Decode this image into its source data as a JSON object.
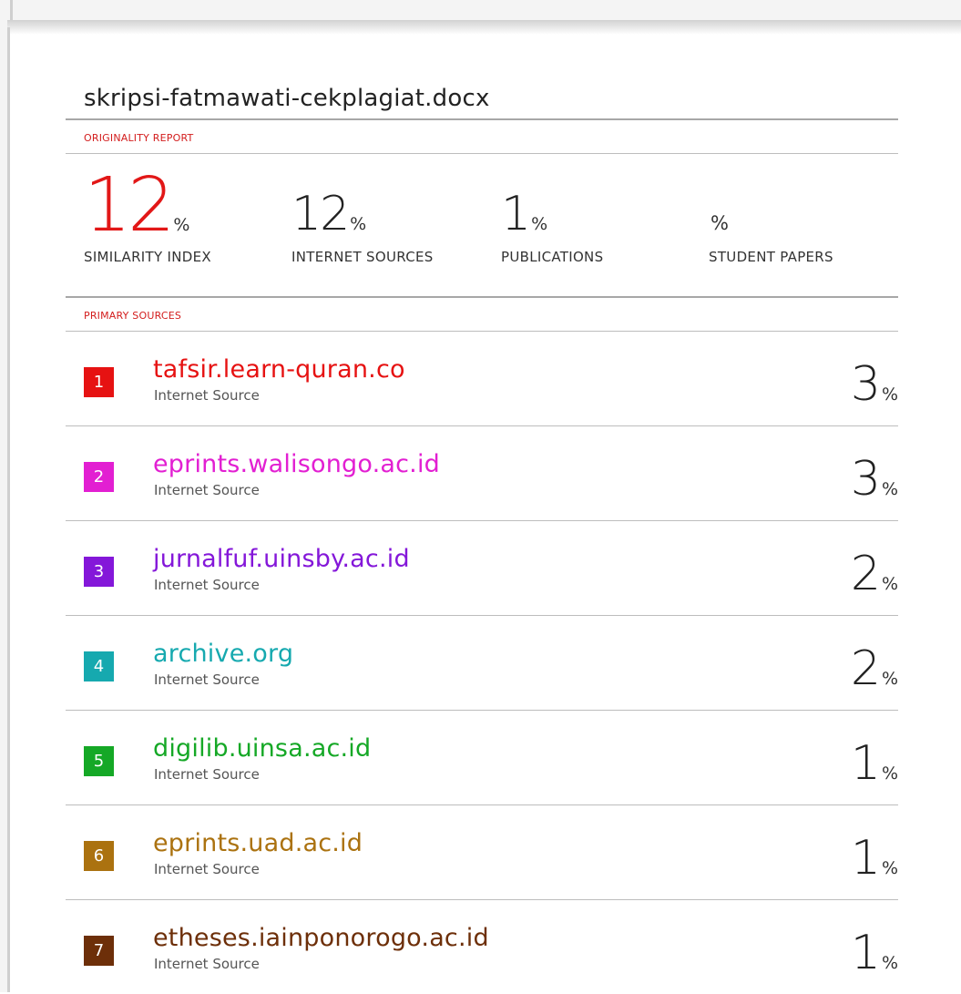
{
  "document": {
    "title": "skripsi-fatmawati-cekplagiat.docx"
  },
  "originality_report": {
    "label": "ORIGINALITY REPORT",
    "stats": [
      {
        "value": "12",
        "percent_sign": "%",
        "label": "SIMILARITY INDEX"
      },
      {
        "value": "12",
        "percent_sign": "%",
        "label": "INTERNET SOURCES"
      },
      {
        "value": "1",
        "percent_sign": "%",
        "label": "PUBLICATIONS"
      },
      {
        "value": "",
        "percent_sign": "%",
        "label": "STUDENT PAPERS"
      }
    ]
  },
  "primary_sources": {
    "label": "PRIMARY SOURCES",
    "items": [
      {
        "rank": "1",
        "name": "tafsir.learn-quran.co",
        "type": "Internet Source",
        "value": "3",
        "percent_sign": "%",
        "color": "#e61212"
      },
      {
        "rank": "2",
        "name": "eprints.walisongo.ac.id",
        "type": "Internet Source",
        "value": "3",
        "percent_sign": "%",
        "color": "#e21fd2"
      },
      {
        "rank": "3",
        "name": "jurnalfuf.uinsby.ac.id",
        "type": "Internet Source",
        "value": "2",
        "percent_sign": "%",
        "color": "#8417d9"
      },
      {
        "rank": "4",
        "name": "archive.org",
        "type": "Internet Source",
        "value": "2",
        "percent_sign": "%",
        "color": "#16a9af"
      },
      {
        "rank": "5",
        "name": "digilib.uinsa.ac.id",
        "type": "Internet Source",
        "value": "1",
        "percent_sign": "%",
        "color": "#15a826"
      },
      {
        "rank": "6",
        "name": "eprints.uad.ac.id",
        "type": "Internet Source",
        "value": "1",
        "percent_sign": "%",
        "color": "#ab7210"
      },
      {
        "rank": "7",
        "name": "etheses.iainponorogo.ac.id",
        "type": "Internet Source",
        "value": "1",
        "percent_sign": "%",
        "color": "#6d2f09"
      }
    ]
  }
}
